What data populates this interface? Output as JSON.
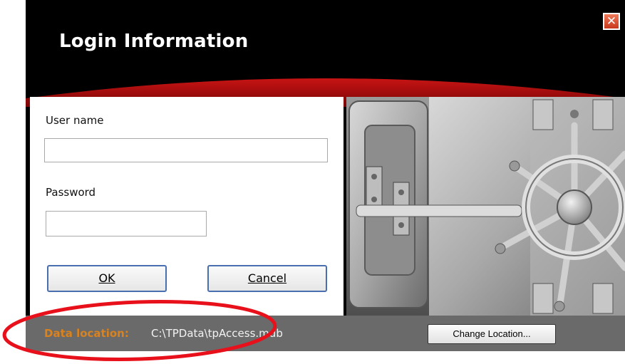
{
  "dialog": {
    "title": "Login Information",
    "close_symbol": "✕"
  },
  "form": {
    "username_label": "User name",
    "username_value": "",
    "password_label": "Password",
    "password_value": "",
    "ok_label": "OK",
    "cancel_label": "Cancel"
  },
  "status_bar": {
    "data_location_label": "Data location:",
    "data_location_path": "C:\\TPData\\tpAccess.mdb",
    "change_location_label": "Change Location..."
  },
  "icons": {
    "close": "close-icon",
    "vault": "vault-door-image",
    "annotation": "red-ellipse-highlight"
  },
  "colors": {
    "header_bg": "#000000",
    "accent_red": "#b01010",
    "data_label": "#d9821e",
    "status_bar_bg": "#6a6a6a",
    "annotation": "#e8101a"
  }
}
